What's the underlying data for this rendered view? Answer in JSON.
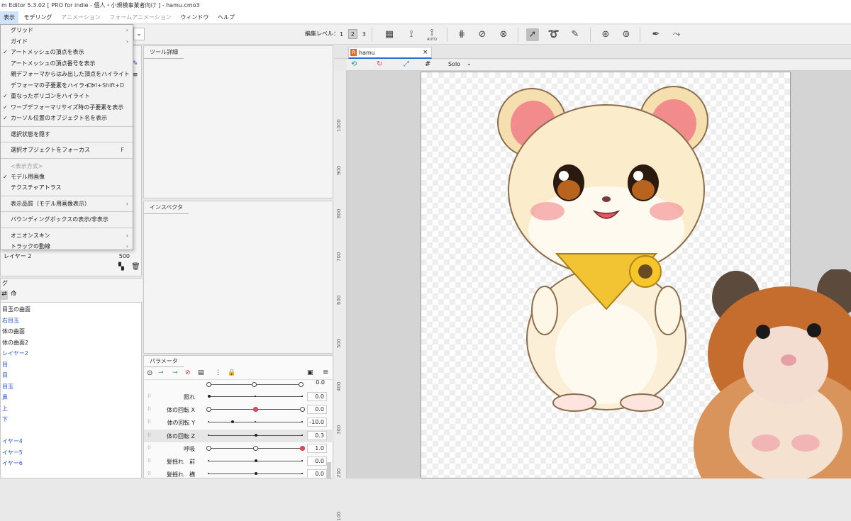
{
  "title": "m Editor 5.3.02  [ PRO for indie - 個人・小規模事業者向け ] - hamu.cmo3",
  "menubar": {
    "items": [
      {
        "label": "表示",
        "state": "active"
      },
      {
        "label": "モデリング",
        "state": "normal"
      },
      {
        "label": "アニメーション",
        "state": "dim"
      },
      {
        "label": "フォームアニメーション",
        "state": "dim"
      },
      {
        "label": "ウィンドウ",
        "state": "normal"
      },
      {
        "label": "ヘルプ",
        "state": "normal"
      }
    ]
  },
  "toolbar": {
    "edit_level_label": "編集レベル：",
    "levels": [
      "1",
      "2",
      "3"
    ],
    "selected_level": "2",
    "auto_label": "AUTO"
  },
  "view_menu": {
    "items": [
      {
        "label": "グリッド",
        "check": false,
        "submenu": true
      },
      {
        "label": "ガイド",
        "check": false,
        "submenu": true
      },
      {
        "label": "アートメッシュの頂点を表示",
        "check": true
      },
      {
        "label": "アートメッシュの頂点番号を表示",
        "check": false
      },
      {
        "label": "親デフォーマからはみ出した頂点をハイライト",
        "check": false
      },
      {
        "label": "デフォーマの子要素をハイライト",
        "check": false,
        "shortcut": "Ctrl+Shift+D"
      },
      {
        "label": "重なったポリゴンをハイライト",
        "check": true
      },
      {
        "label": "ワープデフォーマリサイズ時の子要素を表示",
        "check": true
      },
      {
        "label": "カーソル位置のオブジェクト名を表示",
        "check": true
      },
      {
        "sep": true
      },
      {
        "label": "選択状態を隠す",
        "check": false
      },
      {
        "sep": true
      },
      {
        "label": "選択オブジェクトをフォーカス",
        "check": false,
        "shortcut": "F"
      },
      {
        "sep": true
      },
      {
        "caption": "<表示方式>"
      },
      {
        "label": "モデル用画像",
        "check": true
      },
      {
        "label": "テクスチャアトラス",
        "check": false
      },
      {
        "sep": true
      },
      {
        "label": "表示品質（モデル用画像表示）",
        "check": false,
        "submenu": true
      },
      {
        "sep": true
      },
      {
        "label": "バウンディングボックスの表示/非表示",
        "check": false
      },
      {
        "sep": true
      },
      {
        "label": "オニオンスキン",
        "check": false,
        "submenu": true
      },
      {
        "label": "トラックの動線",
        "check": false,
        "submenu": true
      }
    ]
  },
  "parts_panel": {
    "layer_row": {
      "label": "レイヤー 2",
      "value": "500"
    }
  },
  "deformer_panel": {
    "title": "グ",
    "items": [
      {
        "label": "目玉の曲面",
        "blue": false
      },
      {
        "label": "右目玉",
        "blue": true
      },
      {
        "label": "体の曲面",
        "blue": false
      },
      {
        "label": "体の曲面2",
        "blue": false
      },
      {
        "label": "レイヤー2",
        "blue": true
      },
      {
        "label": "目",
        "blue": true
      },
      {
        "label": "目",
        "blue": true
      },
      {
        "label": "目玉",
        "blue": true
      },
      {
        "label": "鼻",
        "blue": true
      },
      {
        "label": "上",
        "blue": true
      },
      {
        "label": "下",
        "blue": true
      },
      {
        "label": "",
        "blue": false
      },
      {
        "label": "イヤー4",
        "blue": true
      },
      {
        "label": "イヤー5",
        "blue": true
      },
      {
        "label": "イヤー6",
        "blue": true
      }
    ]
  },
  "tool_detail": {
    "title": "ツール詳細"
  },
  "inspector": {
    "title": "インスペクタ"
  },
  "parameters": {
    "title": "パラメータ",
    "top_partial_value": "0.0",
    "rows": [
      {
        "label": "照れ",
        "value": "0.0",
        "style": "dots",
        "pos": 0.0
      },
      {
        "label": "体の回転 X",
        "value": "0.0",
        "style": "keys",
        "pos": 0.5,
        "highlight": true
      },
      {
        "label": "体の回転 Y",
        "value": "-10.0",
        "style": "dots",
        "pos": 0.25
      },
      {
        "label": "体の回転 Z",
        "value": "0.3",
        "style": "dots",
        "pos": 0.5
      },
      {
        "label": "呼吸",
        "value": "1.0",
        "style": "keys",
        "pos": 1.0,
        "highlight": true
      },
      {
        "label": "髪揺れ　前",
        "value": "0.0",
        "style": "dots",
        "pos": 0.5
      },
      {
        "label": "髪揺れ　横",
        "value": "0.0",
        "style": "dots",
        "pos": 0.5
      }
    ]
  },
  "document": {
    "tab_label": "hamu",
    "solo_label": "Solo"
  },
  "ruler": {
    "ticks": [
      "1000",
      "900",
      "800",
      "700",
      "600",
      "500",
      "400",
      "300",
      "200",
      "100"
    ]
  },
  "colors": {
    "menu_active": "#cfe3fa",
    "link_blue": "#2859c5",
    "param_key_red": "#e0495a"
  }
}
